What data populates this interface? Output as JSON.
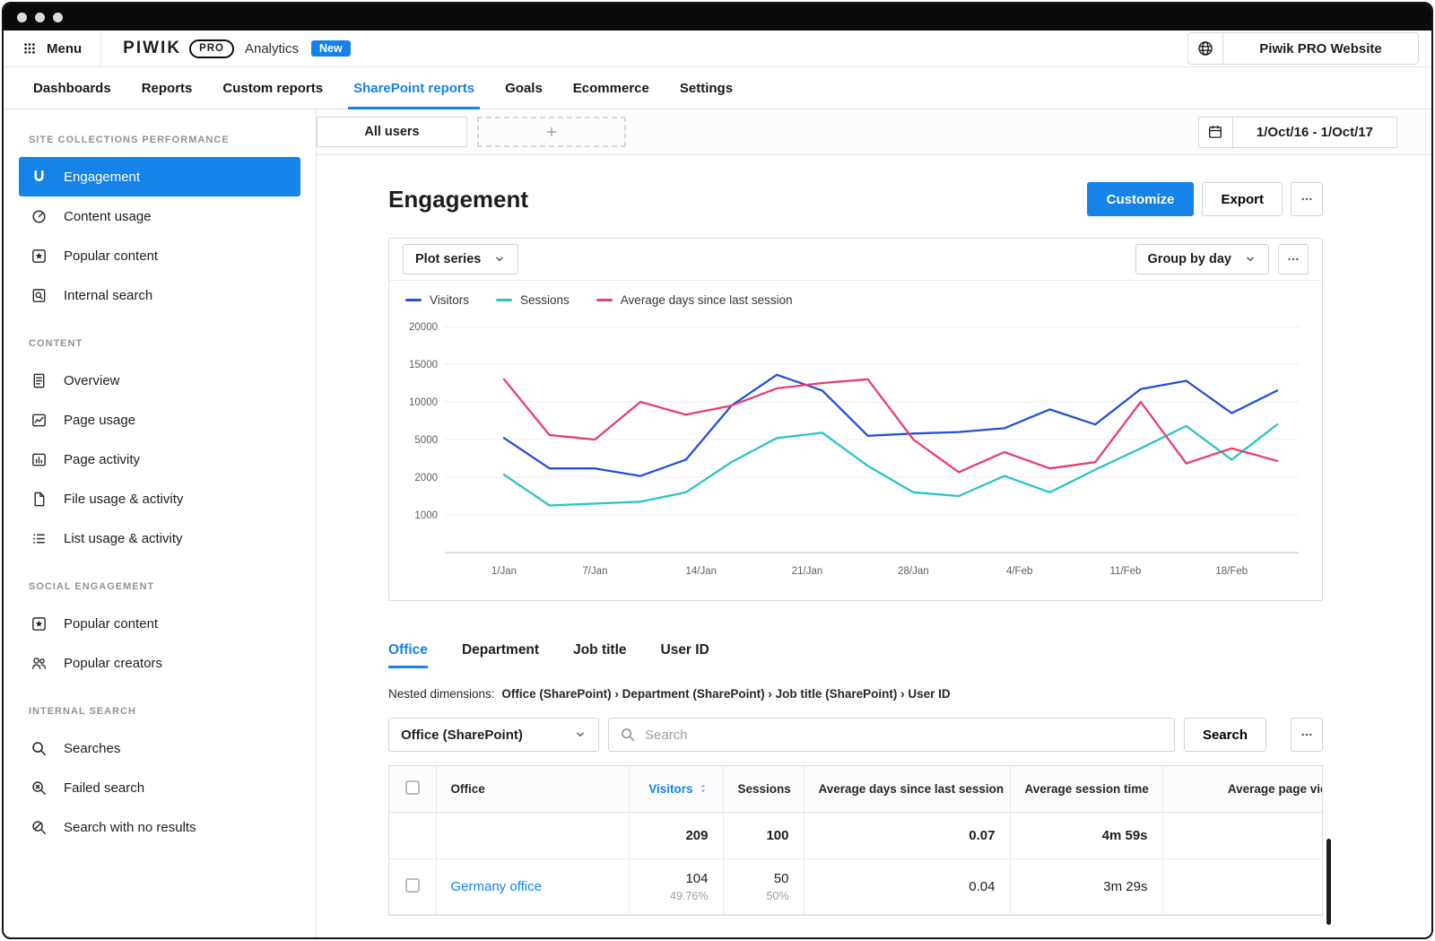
{
  "accent": "#1583e8",
  "header": {
    "menu": "Menu",
    "logo": {
      "piwik": "PIWIK",
      "pro": "PRO",
      "product": "Analytics",
      "badge": "New"
    },
    "site_selector": "Piwik PRO Website"
  },
  "nav": {
    "items": [
      {
        "label": "Dashboards",
        "active": false
      },
      {
        "label": "Reports",
        "active": false
      },
      {
        "label": "Custom reports",
        "active": false
      },
      {
        "label": "SharePoint reports",
        "active": true
      },
      {
        "label": "Goals",
        "active": false
      },
      {
        "label": "Ecommerce",
        "active": false
      },
      {
        "label": "Settings",
        "active": false
      }
    ]
  },
  "sidebar": {
    "sections": [
      {
        "title": "SITE COLLECTIONS PERFORMANCE",
        "items": [
          {
            "label": "Engagement",
            "icon": "piwik-engagement-icon",
            "active": true
          },
          {
            "label": "Content usage",
            "icon": "gauge-icon",
            "active": false
          },
          {
            "label": "Popular content",
            "icon": "star-square-icon",
            "active": false
          },
          {
            "label": "Internal search",
            "icon": "doc-search-icon",
            "active": false
          }
        ]
      },
      {
        "title": "CONTENT",
        "items": [
          {
            "label": "Overview",
            "icon": "document-icon",
            "active": false
          },
          {
            "label": "Page usage",
            "icon": "page-chart-icon",
            "active": false
          },
          {
            "label": "Page activity",
            "icon": "page-bars-icon",
            "active": false
          },
          {
            "label": "File usage & activity",
            "icon": "file-icon",
            "active": false
          },
          {
            "label": "List usage & activity",
            "icon": "list-icon",
            "active": false
          }
        ]
      },
      {
        "title": "SOCIAL ENGAGEMENT",
        "items": [
          {
            "label": "Popular content",
            "icon": "star-square-icon",
            "active": false
          },
          {
            "label": "Popular creators",
            "icon": "people-icon",
            "active": false
          }
        ]
      },
      {
        "title": "INTERNAL SEARCH",
        "items": [
          {
            "label": "Searches",
            "icon": "search-icon",
            "active": false
          },
          {
            "label": "Failed search",
            "icon": "search-failed-icon",
            "active": false
          },
          {
            "label": "Search with no results",
            "icon": "search-none-icon",
            "active": false
          }
        ]
      }
    ]
  },
  "segment_bar": {
    "all_users": "All users",
    "date_range": "1/Oct/16 - 1/Oct/17"
  },
  "page": {
    "title": "Engagement",
    "customize": "Customize",
    "export": "Export"
  },
  "chart_card": {
    "plot_series": "Plot series",
    "group_by": "Group by day"
  },
  "chart_data": {
    "type": "line",
    "y_ticks": [
      1000,
      2000,
      5000,
      10000,
      15000,
      20000
    ],
    "x": [
      0,
      3,
      6,
      9,
      12,
      15,
      18,
      21,
      24,
      27,
      30,
      33,
      36,
      39,
      42,
      45,
      48,
      51
    ],
    "x_tick_days": [
      0,
      6,
      13,
      20,
      27,
      34,
      41,
      48
    ],
    "x_tick_labels": [
      "1/Jan",
      "7/Jan",
      "14/Jan",
      "21/Jan",
      "28/Jan",
      "4/Feb",
      "11/Feb",
      "18/Feb"
    ],
    "series": [
      {
        "name": "Visitors",
        "color": "#2450d8",
        "values": [
          5200,
          2700,
          2700,
          2100,
          3400,
          9500,
          13600,
          11500,
          5500,
          5800,
          6000,
          6500,
          9000,
          7000,
          11700,
          12800,
          8500,
          11500
        ]
      },
      {
        "name": "Sessions",
        "color": "#2bc3c6",
        "values": [
          2200,
          1250,
          1300,
          1350,
          1600,
          3200,
          5200,
          5900,
          2900,
          1600,
          1500,
          2100,
          1600,
          2600,
          4300,
          6800,
          3400,
          7000
        ]
      },
      {
        "name": "Average days since last session",
        "color": "#e73e6f",
        "values": [
          13000,
          5600,
          5000,
          10000,
          8300,
          9500,
          11800,
          12500,
          13000,
          5000,
          2400,
          4000,
          2700,
          3200,
          10000,
          3100,
          4300,
          3300
        ]
      }
    ],
    "legend_position": "top",
    "grid": true
  },
  "dimension_tabs": {
    "items": [
      {
        "label": "Office",
        "active": true
      },
      {
        "label": "Department",
        "active": false
      },
      {
        "label": "Job title",
        "active": false
      },
      {
        "label": "User ID",
        "active": false
      }
    ]
  },
  "nested_dimensions": {
    "label": "Nested dimensions:",
    "value": "Office (SharePoint) › Department (SharePoint) › Job title (SharePoint) › User ID"
  },
  "table_controls": {
    "dimension_select": "Office (SharePoint)",
    "search_placeholder": "Search",
    "search_button": "Search"
  },
  "table": {
    "columns": [
      {
        "key": "checkbox",
        "label": "",
        "type": "checkbox"
      },
      {
        "key": "office",
        "label": "Office",
        "align": "left"
      },
      {
        "key": "visitors",
        "label": "Visitors",
        "align": "right",
        "sortable": true
      },
      {
        "key": "sessions",
        "label": "Sessions",
        "align": "right"
      },
      {
        "key": "avg_days",
        "label": "Average days since last session",
        "align": "right"
      },
      {
        "key": "avg_session_time",
        "label": "Average session time",
        "align": "right"
      },
      {
        "key": "avg_page_views",
        "label": "Average page views in ses",
        "align": "right"
      }
    ],
    "totals_row": {
      "visitors": "209",
      "sessions": "100",
      "avg_days": "0.07",
      "avg_session_time": "4m 59s",
      "avg_page_views": ""
    },
    "rows": [
      {
        "office": "Germany office",
        "visitors": "104",
        "visitors_pct": "49.76%",
        "sessions": "50",
        "sessions_pct": "50%",
        "avg_days": "0.04",
        "avg_session_time": "3m 29s",
        "avg_page_views": ""
      }
    ]
  }
}
